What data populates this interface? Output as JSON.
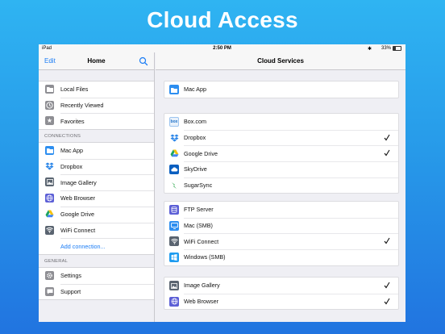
{
  "headline": "Cloud Access",
  "status_bar": {
    "carrier": "iPad",
    "time": "2:50 PM",
    "battery": "33%"
  },
  "master": {
    "nav": {
      "edit_label": "Edit",
      "title": "Home"
    },
    "items_top": [
      {
        "label": "Local Files",
        "icon": "folder-icon"
      },
      {
        "label": "Recently Viewed",
        "icon": "clock-icon"
      },
      {
        "label": "Favorites",
        "icon": "star-icon"
      }
    ],
    "connections_header": "CONNECTIONS",
    "connections": [
      {
        "label": "Mac App",
        "icon": "folder-blue-icon"
      },
      {
        "label": "Dropbox",
        "icon": "dropbox-icon"
      },
      {
        "label": "Image Gallery",
        "icon": "image-icon"
      },
      {
        "label": "Web Browser",
        "icon": "globe-icon"
      },
      {
        "label": "Google Drive",
        "icon": "google-drive-icon"
      },
      {
        "label": "WiFi Connect",
        "icon": "wifi-icon"
      }
    ],
    "add_connection": "Add connection...",
    "general_header": "GENERAL",
    "general": [
      {
        "label": "Settings",
        "icon": "gear-icon"
      },
      {
        "label": "Support",
        "icon": "chat-icon"
      }
    ]
  },
  "detail": {
    "title": "Cloud Services",
    "groups": [
      [
        {
          "label": "Mac App",
          "icon": "folder-blue-icon",
          "checked": false
        }
      ],
      [
        {
          "label": "Box.com",
          "icon": "box-icon",
          "checked": false
        },
        {
          "label": "Dropbox",
          "icon": "dropbox-icon",
          "checked": true
        },
        {
          "label": "Google Drive",
          "icon": "google-drive-icon",
          "checked": true
        },
        {
          "label": "SkyDrive",
          "icon": "skydrive-icon",
          "checked": false
        },
        {
          "label": "SugarSync",
          "icon": "sugarsync-icon",
          "checked": false
        }
      ],
      [
        {
          "label": "FTP Server",
          "icon": "server-icon",
          "checked": false
        },
        {
          "label": "Mac (SMB)",
          "icon": "monitor-icon",
          "checked": false
        },
        {
          "label": "WiFi Connect",
          "icon": "wifi-icon",
          "checked": true
        },
        {
          "label": "Windows (SMB)",
          "icon": "windows-icon",
          "checked": false
        }
      ],
      [
        {
          "label": "Image Gallery",
          "icon": "image-icon",
          "checked": true
        },
        {
          "label": "Web Browser",
          "icon": "globe-icon",
          "checked": true
        }
      ]
    ]
  },
  "colors": {
    "accent": "#1a7cf5",
    "background_top": "#2fb4f2",
    "background_bottom": "#2174e0"
  }
}
